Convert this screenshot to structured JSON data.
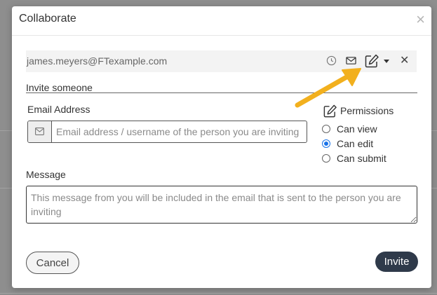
{
  "dialog": {
    "title": "Collaborate",
    "close_glyph": "×"
  },
  "collaborator": {
    "email": "james.meyers@FTexample.com",
    "icons": [
      "clock-icon",
      "envelope-icon",
      "edit-permission-icon",
      "caret-down-icon",
      "remove-icon"
    ],
    "remove_glyph": "✕"
  },
  "invite": {
    "section_label": "Invite someone",
    "email_label": "Email Address",
    "email_placeholder": "Email address / username of the person you are inviting",
    "email_value": ""
  },
  "permissions": {
    "title": "Permissions",
    "options": [
      {
        "label": "Can view",
        "checked": false
      },
      {
        "label": "Can edit",
        "checked": true
      },
      {
        "label": "Can submit",
        "checked": false
      }
    ]
  },
  "message": {
    "label": "Message",
    "placeholder": "This message from you will be included in the email that is sent to the person you are inviting",
    "value": ""
  },
  "actions": {
    "cancel_label": "Cancel",
    "invite_label": "Invite"
  },
  "colors": {
    "overlay": "#8e8e8e",
    "invite_button": "#2f3a4a",
    "arrow": "#f2b01e",
    "radio_accent": "#1a73e8"
  }
}
